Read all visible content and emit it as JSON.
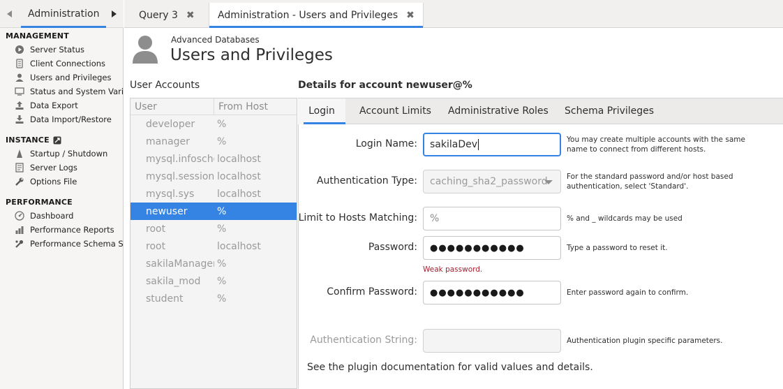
{
  "sidebar": {
    "tab_label": "Administration",
    "sections": {
      "management": "MANAGEMENT",
      "instance": "INSTANCE",
      "performance": "PERFORMANCE"
    },
    "management_items": [
      {
        "label": "Server Status",
        "icon": "play-circle-icon"
      },
      {
        "label": "Client Connections",
        "icon": "server-icon"
      },
      {
        "label": "Users and Privileges",
        "icon": "user-icon"
      },
      {
        "label": "Status and System Variables",
        "icon": "monitor-icon"
      },
      {
        "label": "Data Export",
        "icon": "export-icon"
      },
      {
        "label": "Data Import/Restore",
        "icon": "import-icon"
      }
    ],
    "instance_items": [
      {
        "label": "Startup / Shutdown",
        "icon": "startup-icon"
      },
      {
        "label": "Server Logs",
        "icon": "logs-icon"
      },
      {
        "label": "Options File",
        "icon": "wrench-icon"
      }
    ],
    "performance_items": [
      {
        "label": "Dashboard",
        "icon": "dashboard-icon"
      },
      {
        "label": "Performance Reports",
        "icon": "reports-icon"
      },
      {
        "label": "Performance Schema Setup",
        "icon": "schema-setup-icon"
      }
    ]
  },
  "tabs": [
    {
      "label": "Query 3"
    },
    {
      "label": "Administration - Users and Privileges"
    }
  ],
  "header": {
    "subtitle": "Advanced Databases",
    "title": "Users and Privileges"
  },
  "accounts": {
    "heading": "User Accounts",
    "columns": {
      "user": "User",
      "host": "From Host"
    },
    "rows": [
      {
        "user": "developer",
        "host": "%"
      },
      {
        "user": "manager",
        "host": "%"
      },
      {
        "user": "mysql.infoschema",
        "host": "localhost"
      },
      {
        "user": "mysql.session",
        "host": "localhost"
      },
      {
        "user": "mysql.sys",
        "host": "localhost"
      },
      {
        "user": "newuser",
        "host": "%"
      },
      {
        "user": "root",
        "host": "%"
      },
      {
        "user": "root",
        "host": "localhost"
      },
      {
        "user": "sakilaManager",
        "host": "%"
      },
      {
        "user": "sakila_mod",
        "host": "%"
      },
      {
        "user": "student",
        "host": "%"
      }
    ],
    "selected_index": 5
  },
  "details": {
    "heading": "Details for account newuser@%",
    "tabs": [
      "Login",
      "Account Limits",
      "Administrative Roles",
      "Schema Privileges"
    ],
    "login_name": {
      "label": "Login Name:",
      "value": "sakilaDev",
      "help": "You may create multiple accounts with the same name to connect from different hosts."
    },
    "auth_type": {
      "label": "Authentication Type:",
      "value": "caching_sha2_password",
      "help": "For the standard password and/or host based authentication, select 'Standard'."
    },
    "hosts": {
      "label": "Limit to Hosts Matching:",
      "value": "%",
      "help": "% and _ wildcards may be used"
    },
    "password": {
      "label": "Password:",
      "value": "●●●●●●●●●●●",
      "help": "Type a password to reset it."
    },
    "password_strength": "Weak password.",
    "confirm_password": {
      "label": "Confirm Password:",
      "value": "●●●●●●●●●●●",
      "help": "Enter password again to confirm."
    },
    "auth_string": {
      "label": "Authentication String:",
      "value": "",
      "help": "Authentication plugin specific parameters."
    },
    "plugin_note": "See the plugin documentation for valid values and details."
  }
}
